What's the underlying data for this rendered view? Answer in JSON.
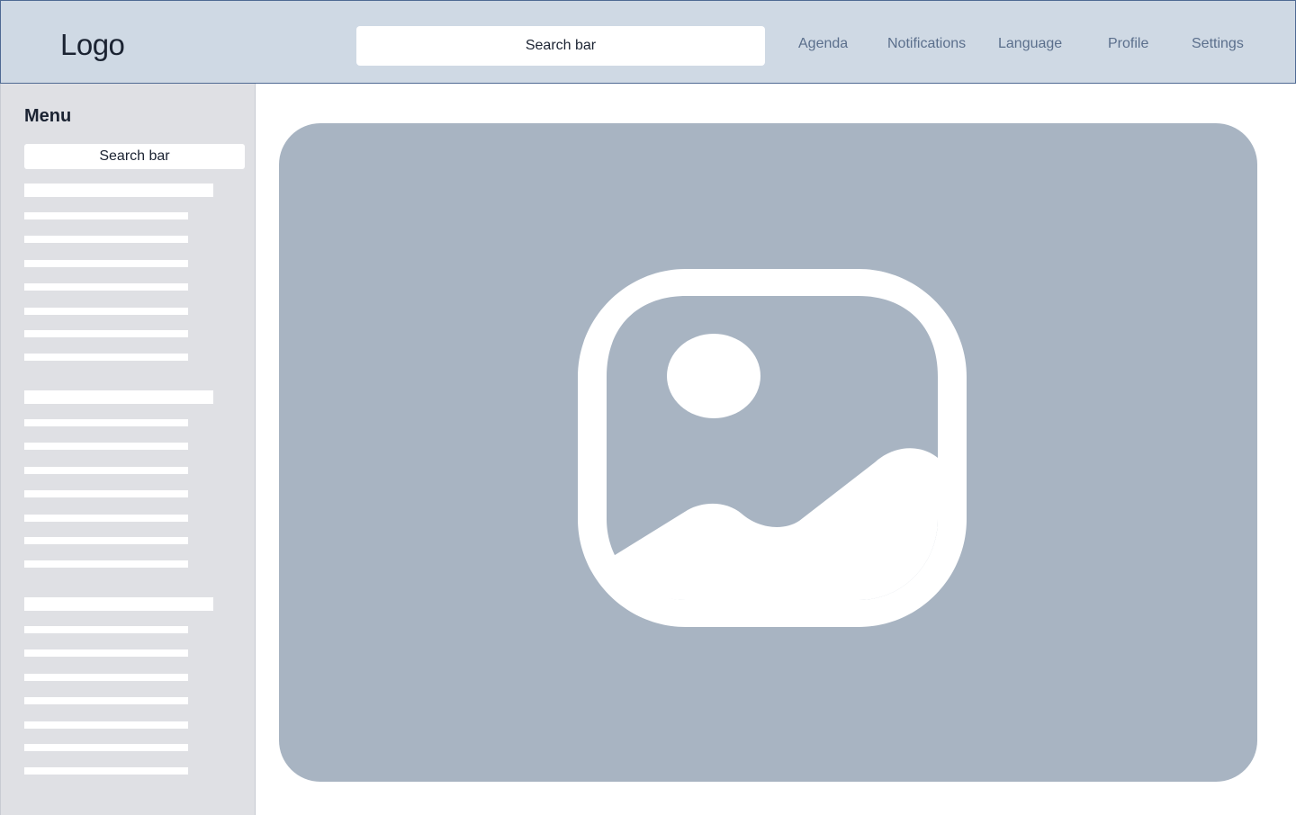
{
  "header": {
    "logo": "Logo",
    "search_label": "Search bar",
    "nav": [
      "Agenda",
      "Notifications",
      "Language",
      "Profile",
      "Settings"
    ]
  },
  "sidebar": {
    "title": "Menu",
    "search_label": "Search bar"
  },
  "main": {
    "placeholder_icon": "image-icon"
  },
  "colors": {
    "header_bg": "#cfd9e4",
    "header_border": "#4f6a93",
    "nav_text": "#5b6f8c",
    "sidebar_bg": "#dfe0e4",
    "image_placeholder": "#a8b4c2"
  }
}
